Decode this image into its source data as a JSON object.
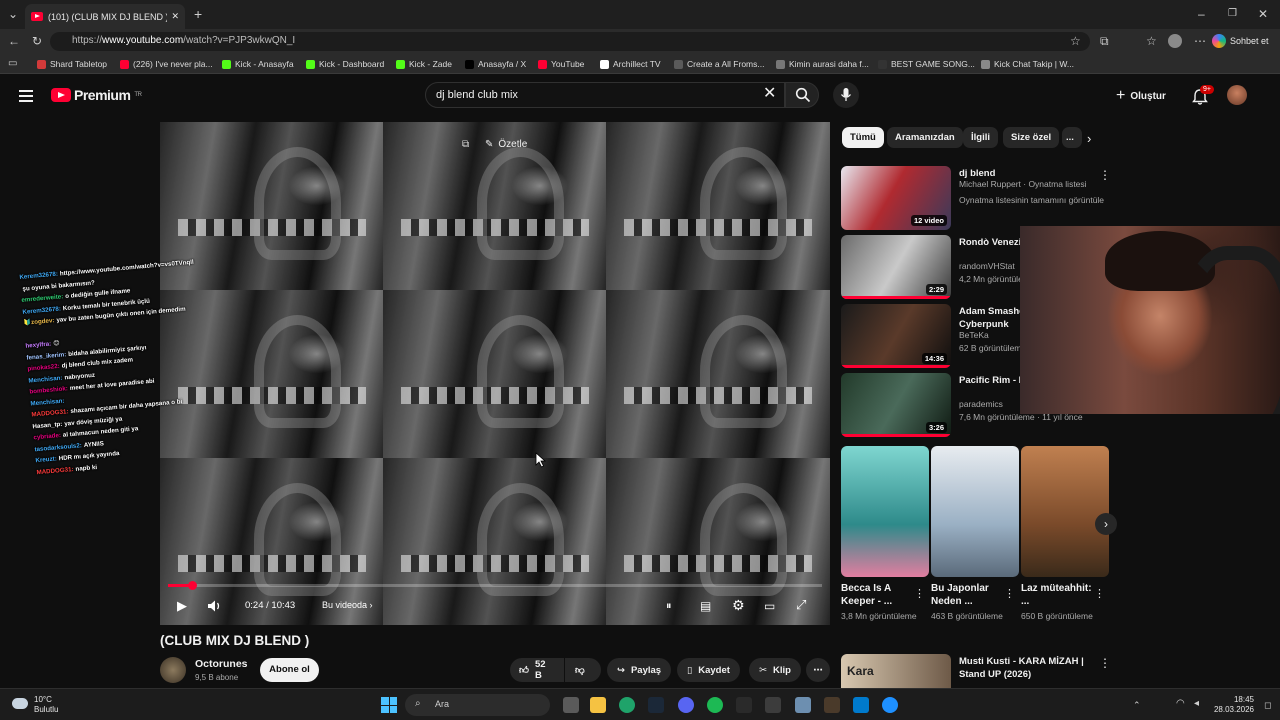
{
  "browser": {
    "tab_title": "(101) (CLUB MIX DJ BLEND ) - You",
    "url_prefix": "https://",
    "url_host": "www.youtube.com",
    "url_path": "/watch?v=PJP3wkwQN_I",
    "copilot_label": "Sohbet et",
    "bookmarks": [
      {
        "label": "Shard Tabletop",
        "color": "#d23a3a"
      },
      {
        "label": "(226) I've never pla...",
        "color": "#ff0033"
      },
      {
        "label": "Kick - Anasayfa",
        "color": "#53fc18"
      },
      {
        "label": "Kick - Dashboard",
        "color": "#53fc18"
      },
      {
        "label": "Kick - Zade",
        "color": "#53fc18"
      },
      {
        "label": "Anasayfa / X",
        "color": "#000000"
      },
      {
        "label": "YouTube",
        "color": "#ff0033"
      },
      {
        "label": "Archillect TV",
        "color": "#ffffff"
      },
      {
        "label": "Create a All Froms...",
        "color": "#5a5a5a"
      },
      {
        "label": "Kimin aurasi daha f...",
        "color": "#777777"
      },
      {
        "label": "BEST GAME SONG...",
        "color": "#333333"
      },
      {
        "label": "Kick Chat Takip | W...",
        "color": "#888888"
      }
    ]
  },
  "header": {
    "logo_text": "Premium",
    "logo_region": "TR",
    "search_value": "dj blend club mix",
    "create_label": "Oluştur",
    "notification_count": "9+"
  },
  "player": {
    "summarize_label": "Özetle",
    "time": "0:24 / 10:43",
    "chapter_label": "Bu videoda",
    "progress": 0.037
  },
  "chat": [
    {
      "user": "Kerem32678:",
      "user_color": "#3fa9f5",
      "msg": "https://www.youtube.com/watch?v=vs0TVnqIl"
    },
    {
      "user": "",
      "user_color": "#ffffff",
      "msg": "şu oyuna bi bakarmısın?"
    },
    {
      "user": "emrederweite:",
      "user_color": "#2ecc71",
      "msg": "o dediğin gulle ifname"
    },
    {
      "user": "Kerem32678:",
      "user_color": "#3fa9f5",
      "msg": "Korku temalı bir tenebrik üçlü"
    },
    {
      "user": "🔰zogdev:",
      "user_color": "#e8b84a",
      "msg": "yav bu zaten bugün çıktı onen için demedim"
    },
    {
      "user": "",
      "user_color": "#ffffff",
      "msg": ""
    },
    {
      "user": "hexylfra:",
      "user_color": "#c77dff",
      "msg": "😊"
    },
    {
      "user": "fenas_ikerim:",
      "user_color": "#a0c4ff",
      "msg": "bidaha alabilirmiyiz şarkıyı"
    },
    {
      "user": "pinokas22:",
      "user_color": "#e6007e",
      "msg": "dj blend club mix zadem"
    },
    {
      "user": "Menchisan:",
      "user_color": "#3fa9f5",
      "msg": "nabıyonuz"
    },
    {
      "user": "bombeshiok:",
      "user_color": "#e6007e",
      "msg": "meet her at love paradise abi"
    },
    {
      "user": "Menchisan:",
      "user_color": "#3fa9f5",
      "msg": ""
    },
    {
      "user": "MADDOG31:",
      "user_color": "#ff3b3b",
      "msg": "shazamı açıcam bir daha yapsana o bi"
    },
    {
      "user": "Hasan_tp:",
      "user_color": "#ffffff",
      "msg": "yav döviş müziği ya"
    },
    {
      "user": "cybriade:",
      "user_color": "#e6007e",
      "msg": "al tahmacun neden giti ya"
    },
    {
      "user": "tasodarksouls2:",
      "user_color": "#3fa9f5",
      "msg": "AYNIIS"
    },
    {
      "user": "Kreuzt:",
      "user_color": "#3fa9f5",
      "msg": "HDR mı açık yayında"
    },
    {
      "user": "MADDOG31:",
      "user_color": "#ff3b3b",
      "msg": "napb ki"
    }
  ],
  "video": {
    "title": "(CLUB MIX DJ BLEND )",
    "channel": "Octorunes",
    "subscribers": "9,5 B abone",
    "subscribe_label": "Abone ol",
    "likes": "52 B",
    "share_label": "Paylaş",
    "save_label": "Kaydet",
    "clip_label": "Klip"
  },
  "chips": [
    "Tümü",
    "Aramanızdan",
    "İlgili",
    "Size özel",
    "..."
  ],
  "recommendations": [
    {
      "title": "dj blend",
      "channel": "Michael Ruppert · Oynatma listesi",
      "meta": "Oynatma listesinin tamamını görüntüle",
      "badge": "12 video",
      "progress": 0
    },
    {
      "title": "Rondò Venezia Serenissima",
      "channel": "randomVHStat",
      "meta": "4,2 Mn görüntüleme",
      "badge": "2:29",
      "progress": 1.0
    },
    {
      "title": "Adam Smasher Hikayesi | Cyberpunk",
      "channel": "BeTeKa",
      "meta": "62 B görüntüleme",
      "badge": "14:36",
      "progress": 1.0
    },
    {
      "title": "Pacific Rim - Epic Cover",
      "channel": "parademics",
      "meta": "7,6 Mn görüntüleme · 11 yıl önce",
      "badge": "3:26",
      "progress": 1.0
    }
  ],
  "shorts": [
    {
      "title": "Becca Is A Keeper - ...",
      "views": "3,8 Mn görüntüleme"
    },
    {
      "title": "Bu Japonlar Neden ...",
      "views": "463 B görüntüleme"
    },
    {
      "title": "Laz müteahhit: ...",
      "views": "650 B görüntüleme"
    }
  ],
  "next_rec": {
    "title": "Musti Kusti - KARA MİZAH | Stand UP (2026)"
  },
  "taskbar": {
    "weather_temp": "10°C",
    "weather_desc": "Bulutlu",
    "search_label": "Ara",
    "time": "18:45",
    "date": "28.03.2026"
  }
}
